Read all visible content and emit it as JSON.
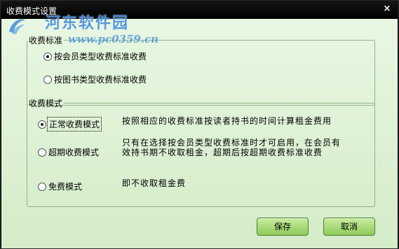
{
  "window": {
    "title": "收费模式设置",
    "close_glyph": "×"
  },
  "watermark": {
    "site_name": "河东软件园",
    "url": "www.pc0359.cn"
  },
  "fee_standard": {
    "legend": "收费标准",
    "options": [
      {
        "label": "按会员类型收费标准收费",
        "checked": true
      },
      {
        "label": "按图书类型收费标准收费",
        "checked": false
      }
    ]
  },
  "fee_mode": {
    "legend": "收费模式",
    "options": [
      {
        "label": "正常收费模式",
        "checked": true,
        "description_lines": [
          "按照相应的收费标准按读者持书的时间计算租金费用"
        ]
      },
      {
        "label": "超期收费模式",
        "checked": false,
        "description_lines": [
          "只有在选择按会员类型收费标准时才可启用，在会员有",
          "效持书期不收取租金，超期后按超期收费标准收费"
        ]
      },
      {
        "label": "免费模式",
        "checked": false,
        "description_lines": [
          "即不收取租金费"
        ]
      }
    ]
  },
  "buttons": {
    "save": "保存",
    "cancel": "取消"
  },
  "colors": {
    "title_bar": "#000000",
    "dialog_background": "#dff2d8",
    "button_green": "#a9db78"
  }
}
